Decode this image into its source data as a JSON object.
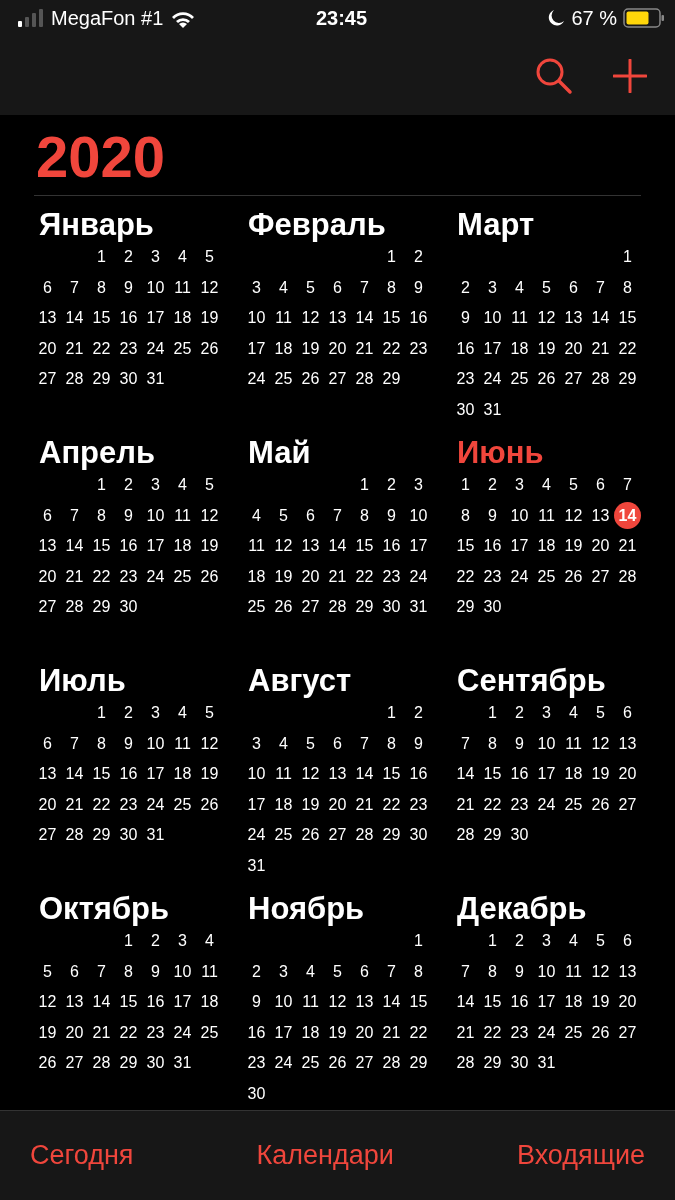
{
  "status_bar": {
    "carrier": "MegaFon #1",
    "time": "23:45",
    "battery": "67 %"
  },
  "year": "2020",
  "months": [
    {
      "name": "Январь",
      "current": false,
      "weeks": [
        [
          {
            "d": "1",
            "today": false
          },
          {
            "d": "2",
            "today": false
          },
          {
            "d": "3",
            "today": false
          },
          {
            "d": "4",
            "today": false
          },
          {
            "d": "5",
            "today": false
          }
        ],
        [
          {
            "d": "6",
            "today": false
          },
          {
            "d": "7",
            "today": false
          },
          {
            "d": "8",
            "today": false
          },
          {
            "d": "9",
            "today": false
          },
          {
            "d": "10",
            "today": false
          },
          {
            "d": "11",
            "today": false
          },
          {
            "d": "12",
            "today": false
          }
        ],
        [
          {
            "d": "13",
            "today": false
          },
          {
            "d": "14",
            "today": false
          },
          {
            "d": "15",
            "today": false
          },
          {
            "d": "16",
            "today": false
          },
          {
            "d": "17",
            "today": false
          },
          {
            "d": "18",
            "today": false
          },
          {
            "d": "19",
            "today": false
          }
        ],
        [
          {
            "d": "20",
            "today": false
          },
          {
            "d": "21",
            "today": false
          },
          {
            "d": "22",
            "today": false
          },
          {
            "d": "23",
            "today": false
          },
          {
            "d": "24",
            "today": false
          },
          {
            "d": "25",
            "today": false
          },
          {
            "d": "26",
            "today": false
          }
        ],
        [
          {
            "d": "27",
            "today": false
          },
          {
            "d": "28",
            "today": false
          },
          {
            "d": "29",
            "today": false
          },
          {
            "d": "30",
            "today": false
          },
          {
            "d": "31",
            "today": false
          }
        ]
      ]
    },
    {
      "name": "Февраль",
      "current": false,
      "weeks": [
        [
          {
            "d": "1",
            "today": false
          },
          {
            "d": "2",
            "today": false
          }
        ],
        [
          {
            "d": "3",
            "today": false
          },
          {
            "d": "4",
            "today": false
          },
          {
            "d": "5",
            "today": false
          },
          {
            "d": "6",
            "today": false
          },
          {
            "d": "7",
            "today": false
          },
          {
            "d": "8",
            "today": false
          },
          {
            "d": "9",
            "today": false
          }
        ],
        [
          {
            "d": "10",
            "today": false
          },
          {
            "d": "11",
            "today": false
          },
          {
            "d": "12",
            "today": false
          },
          {
            "d": "13",
            "today": false
          },
          {
            "d": "14",
            "today": false
          },
          {
            "d": "15",
            "today": false
          },
          {
            "d": "16",
            "today": false
          }
        ],
        [
          {
            "d": "17",
            "today": false
          },
          {
            "d": "18",
            "today": false
          },
          {
            "d": "19",
            "today": false
          },
          {
            "d": "20",
            "today": false
          },
          {
            "d": "21",
            "today": false
          },
          {
            "d": "22",
            "today": false
          },
          {
            "d": "23",
            "today": false
          }
        ],
        [
          {
            "d": "24",
            "today": false
          },
          {
            "d": "25",
            "today": false
          },
          {
            "d": "26",
            "today": false
          },
          {
            "d": "27",
            "today": false
          },
          {
            "d": "28",
            "today": false
          },
          {
            "d": "29",
            "today": false
          }
        ]
      ]
    },
    {
      "name": "Март",
      "current": false,
      "weeks": [
        [
          {
            "d": "1",
            "today": false
          }
        ],
        [
          {
            "d": "2",
            "today": false
          },
          {
            "d": "3",
            "today": false
          },
          {
            "d": "4",
            "today": false
          },
          {
            "d": "5",
            "today": false
          },
          {
            "d": "6",
            "today": false
          },
          {
            "d": "7",
            "today": false
          },
          {
            "d": "8",
            "today": false
          }
        ],
        [
          {
            "d": "9",
            "today": false
          },
          {
            "d": "10",
            "today": false
          },
          {
            "d": "11",
            "today": false
          },
          {
            "d": "12",
            "today": false
          },
          {
            "d": "13",
            "today": false
          },
          {
            "d": "14",
            "today": false
          },
          {
            "d": "15",
            "today": false
          }
        ],
        [
          {
            "d": "16",
            "today": false
          },
          {
            "d": "17",
            "today": false
          },
          {
            "d": "18",
            "today": false
          },
          {
            "d": "19",
            "today": false
          },
          {
            "d": "20",
            "today": false
          },
          {
            "d": "21",
            "today": false
          },
          {
            "d": "22",
            "today": false
          }
        ],
        [
          {
            "d": "23",
            "today": false
          },
          {
            "d": "24",
            "today": false
          },
          {
            "d": "25",
            "today": false
          },
          {
            "d": "26",
            "today": false
          },
          {
            "d": "27",
            "today": false
          },
          {
            "d": "28",
            "today": false
          },
          {
            "d": "29",
            "today": false
          }
        ],
        [
          {
            "d": "30",
            "today": false
          },
          {
            "d": "31",
            "today": false
          }
        ]
      ]
    },
    {
      "name": "Апрель",
      "current": false,
      "weeks": [
        [
          {
            "d": "1",
            "today": false
          },
          {
            "d": "2",
            "today": false
          },
          {
            "d": "3",
            "today": false
          },
          {
            "d": "4",
            "today": false
          },
          {
            "d": "5",
            "today": false
          }
        ],
        [
          {
            "d": "6",
            "today": false
          },
          {
            "d": "7",
            "today": false
          },
          {
            "d": "8",
            "today": false
          },
          {
            "d": "9",
            "today": false
          },
          {
            "d": "10",
            "today": false
          },
          {
            "d": "11",
            "today": false
          },
          {
            "d": "12",
            "today": false
          }
        ],
        [
          {
            "d": "13",
            "today": false
          },
          {
            "d": "14",
            "today": false
          },
          {
            "d": "15",
            "today": false
          },
          {
            "d": "16",
            "today": false
          },
          {
            "d": "17",
            "today": false
          },
          {
            "d": "18",
            "today": false
          },
          {
            "d": "19",
            "today": false
          }
        ],
        [
          {
            "d": "20",
            "today": false
          },
          {
            "d": "21",
            "today": false
          },
          {
            "d": "22",
            "today": false
          },
          {
            "d": "23",
            "today": false
          },
          {
            "d": "24",
            "today": false
          },
          {
            "d": "25",
            "today": false
          },
          {
            "d": "26",
            "today": false
          }
        ],
        [
          {
            "d": "27",
            "today": false
          },
          {
            "d": "28",
            "today": false
          },
          {
            "d": "29",
            "today": false
          },
          {
            "d": "30",
            "today": false
          }
        ]
      ]
    },
    {
      "name": "Май",
      "current": false,
      "weeks": [
        [
          {
            "d": "1",
            "today": false
          },
          {
            "d": "2",
            "today": false
          },
          {
            "d": "3",
            "today": false
          }
        ],
        [
          {
            "d": "4",
            "today": false
          },
          {
            "d": "5",
            "today": false
          },
          {
            "d": "6",
            "today": false
          },
          {
            "d": "7",
            "today": false
          },
          {
            "d": "8",
            "today": false
          },
          {
            "d": "9",
            "today": false
          },
          {
            "d": "10",
            "today": false
          }
        ],
        [
          {
            "d": "11",
            "today": false
          },
          {
            "d": "12",
            "today": false
          },
          {
            "d": "13",
            "today": false
          },
          {
            "d": "14",
            "today": false
          },
          {
            "d": "15",
            "today": false
          },
          {
            "d": "16",
            "today": false
          },
          {
            "d": "17",
            "today": false
          }
        ],
        [
          {
            "d": "18",
            "today": false
          },
          {
            "d": "19",
            "today": false
          },
          {
            "d": "20",
            "today": false
          },
          {
            "d": "21",
            "today": false
          },
          {
            "d": "22",
            "today": false
          },
          {
            "d": "23",
            "today": false
          },
          {
            "d": "24",
            "today": false
          }
        ],
        [
          {
            "d": "25",
            "today": false
          },
          {
            "d": "26",
            "today": false
          },
          {
            "d": "27",
            "today": false
          },
          {
            "d": "28",
            "today": false
          },
          {
            "d": "29",
            "today": false
          },
          {
            "d": "30",
            "today": false
          },
          {
            "d": "31",
            "today": false
          }
        ]
      ]
    },
    {
      "name": "Июнь",
      "current": true,
      "weeks": [
        [
          {
            "d": "1",
            "today": false
          },
          {
            "d": "2",
            "today": false
          },
          {
            "d": "3",
            "today": false
          },
          {
            "d": "4",
            "today": false
          },
          {
            "d": "5",
            "today": false
          },
          {
            "d": "6",
            "today": false
          },
          {
            "d": "7",
            "today": false
          }
        ],
        [
          {
            "d": "8",
            "today": false
          },
          {
            "d": "9",
            "today": false
          },
          {
            "d": "10",
            "today": false
          },
          {
            "d": "11",
            "today": false
          },
          {
            "d": "12",
            "today": false
          },
          {
            "d": "13",
            "today": false
          },
          {
            "d": "14",
            "today": true
          }
        ],
        [
          {
            "d": "15",
            "today": false
          },
          {
            "d": "16",
            "today": false
          },
          {
            "d": "17",
            "today": false
          },
          {
            "d": "18",
            "today": false
          },
          {
            "d": "19",
            "today": false
          },
          {
            "d": "20",
            "today": false
          },
          {
            "d": "21",
            "today": false
          }
        ],
        [
          {
            "d": "22",
            "today": false
          },
          {
            "d": "23",
            "today": false
          },
          {
            "d": "24",
            "today": false
          },
          {
            "d": "25",
            "today": false
          },
          {
            "d": "26",
            "today": false
          },
          {
            "d": "27",
            "today": false
          },
          {
            "d": "28",
            "today": false
          }
        ],
        [
          {
            "d": "29",
            "today": false
          },
          {
            "d": "30",
            "today": false
          }
        ]
      ]
    },
    {
      "name": "Июль",
      "current": false,
      "weeks": [
        [
          {
            "d": "1",
            "today": false
          },
          {
            "d": "2",
            "today": false
          },
          {
            "d": "3",
            "today": false
          },
          {
            "d": "4",
            "today": false
          },
          {
            "d": "5",
            "today": false
          }
        ],
        [
          {
            "d": "6",
            "today": false
          },
          {
            "d": "7",
            "today": false
          },
          {
            "d": "8",
            "today": false
          },
          {
            "d": "9",
            "today": false
          },
          {
            "d": "10",
            "today": false
          },
          {
            "d": "11",
            "today": false
          },
          {
            "d": "12",
            "today": false
          }
        ],
        [
          {
            "d": "13",
            "today": false
          },
          {
            "d": "14",
            "today": false
          },
          {
            "d": "15",
            "today": false
          },
          {
            "d": "16",
            "today": false
          },
          {
            "d": "17",
            "today": false
          },
          {
            "d": "18",
            "today": false
          },
          {
            "d": "19",
            "today": false
          }
        ],
        [
          {
            "d": "20",
            "today": false
          },
          {
            "d": "21",
            "today": false
          },
          {
            "d": "22",
            "today": false
          },
          {
            "d": "23",
            "today": false
          },
          {
            "d": "24",
            "today": false
          },
          {
            "d": "25",
            "today": false
          },
          {
            "d": "26",
            "today": false
          }
        ],
        [
          {
            "d": "27",
            "today": false
          },
          {
            "d": "28",
            "today": false
          },
          {
            "d": "29",
            "today": false
          },
          {
            "d": "30",
            "today": false
          },
          {
            "d": "31",
            "today": false
          }
        ]
      ]
    },
    {
      "name": "Август",
      "current": false,
      "weeks": [
        [
          {
            "d": "1",
            "today": false
          },
          {
            "d": "2",
            "today": false
          }
        ],
        [
          {
            "d": "3",
            "today": false
          },
          {
            "d": "4",
            "today": false
          },
          {
            "d": "5",
            "today": false
          },
          {
            "d": "6",
            "today": false
          },
          {
            "d": "7",
            "today": false
          },
          {
            "d": "8",
            "today": false
          },
          {
            "d": "9",
            "today": false
          }
        ],
        [
          {
            "d": "10",
            "today": false
          },
          {
            "d": "11",
            "today": false
          },
          {
            "d": "12",
            "today": false
          },
          {
            "d": "13",
            "today": false
          },
          {
            "d": "14",
            "today": false
          },
          {
            "d": "15",
            "today": false
          },
          {
            "d": "16",
            "today": false
          }
        ],
        [
          {
            "d": "17",
            "today": false
          },
          {
            "d": "18",
            "today": false
          },
          {
            "d": "19",
            "today": false
          },
          {
            "d": "20",
            "today": false
          },
          {
            "d": "21",
            "today": false
          },
          {
            "d": "22",
            "today": false
          },
          {
            "d": "23",
            "today": false
          }
        ],
        [
          {
            "d": "24",
            "today": false
          },
          {
            "d": "25",
            "today": false
          },
          {
            "d": "26",
            "today": false
          },
          {
            "d": "27",
            "today": false
          },
          {
            "d": "28",
            "today": false
          },
          {
            "d": "29",
            "today": false
          },
          {
            "d": "30",
            "today": false
          }
        ],
        [
          {
            "d": "31",
            "today": false
          }
        ]
      ]
    },
    {
      "name": "Сентябрь",
      "current": false,
      "weeks": [
        [
          {
            "d": "1",
            "today": false
          },
          {
            "d": "2",
            "today": false
          },
          {
            "d": "3",
            "today": false
          },
          {
            "d": "4",
            "today": false
          },
          {
            "d": "5",
            "today": false
          },
          {
            "d": "6",
            "today": false
          }
        ],
        [
          {
            "d": "7",
            "today": false
          },
          {
            "d": "8",
            "today": false
          },
          {
            "d": "9",
            "today": false
          },
          {
            "d": "10",
            "today": false
          },
          {
            "d": "11",
            "today": false
          },
          {
            "d": "12",
            "today": false
          },
          {
            "d": "13",
            "today": false
          }
        ],
        [
          {
            "d": "14",
            "today": false
          },
          {
            "d": "15",
            "today": false
          },
          {
            "d": "16",
            "today": false
          },
          {
            "d": "17",
            "today": false
          },
          {
            "d": "18",
            "today": false
          },
          {
            "d": "19",
            "today": false
          },
          {
            "d": "20",
            "today": false
          }
        ],
        [
          {
            "d": "21",
            "today": false
          },
          {
            "d": "22",
            "today": false
          },
          {
            "d": "23",
            "today": false
          },
          {
            "d": "24",
            "today": false
          },
          {
            "d": "25",
            "today": false
          },
          {
            "d": "26",
            "today": false
          },
          {
            "d": "27",
            "today": false
          }
        ],
        [
          {
            "d": "28",
            "today": false
          },
          {
            "d": "29",
            "today": false
          },
          {
            "d": "30",
            "today": false
          }
        ]
      ]
    },
    {
      "name": "Октябрь",
      "current": false,
      "weeks": [
        [
          {
            "d": "1",
            "today": false
          },
          {
            "d": "2",
            "today": false
          },
          {
            "d": "3",
            "today": false
          },
          {
            "d": "4",
            "today": false
          }
        ],
        [
          {
            "d": "5",
            "today": false
          },
          {
            "d": "6",
            "today": false
          },
          {
            "d": "7",
            "today": false
          },
          {
            "d": "8",
            "today": false
          },
          {
            "d": "9",
            "today": false
          },
          {
            "d": "10",
            "today": false
          },
          {
            "d": "11",
            "today": false
          }
        ],
        [
          {
            "d": "12",
            "today": false
          },
          {
            "d": "13",
            "today": false
          },
          {
            "d": "14",
            "today": false
          },
          {
            "d": "15",
            "today": false
          },
          {
            "d": "16",
            "today": false
          },
          {
            "d": "17",
            "today": false
          },
          {
            "d": "18",
            "today": false
          }
        ],
        [
          {
            "d": "19",
            "today": false
          },
          {
            "d": "20",
            "today": false
          },
          {
            "d": "21",
            "today": false
          },
          {
            "d": "22",
            "today": false
          },
          {
            "d": "23",
            "today": false
          },
          {
            "d": "24",
            "today": false
          },
          {
            "d": "25",
            "today": false
          }
        ],
        [
          {
            "d": "26",
            "today": false
          },
          {
            "d": "27",
            "today": false
          },
          {
            "d": "28",
            "today": false
          },
          {
            "d": "29",
            "today": false
          },
          {
            "d": "30",
            "today": false
          },
          {
            "d": "31",
            "today": false
          }
        ]
      ]
    },
    {
      "name": "Ноябрь",
      "current": false,
      "weeks": [
        [
          {
            "d": "1",
            "today": false
          }
        ],
        [
          {
            "d": "2",
            "today": false
          },
          {
            "d": "3",
            "today": false
          },
          {
            "d": "4",
            "today": false
          },
          {
            "d": "5",
            "today": false
          },
          {
            "d": "6",
            "today": false
          },
          {
            "d": "7",
            "today": false
          },
          {
            "d": "8",
            "today": false
          }
        ],
        [
          {
            "d": "9",
            "today": false
          },
          {
            "d": "10",
            "today": false
          },
          {
            "d": "11",
            "today": false
          },
          {
            "d": "12",
            "today": false
          },
          {
            "d": "13",
            "today": false
          },
          {
            "d": "14",
            "today": false
          },
          {
            "d": "15",
            "today": false
          }
        ],
        [
          {
            "d": "16",
            "today": false
          },
          {
            "d": "17",
            "today": false
          },
          {
            "d": "18",
            "today": false
          },
          {
            "d": "19",
            "today": false
          },
          {
            "d": "20",
            "today": false
          },
          {
            "d": "21",
            "today": false
          },
          {
            "d": "22",
            "today": false
          }
        ],
        [
          {
            "d": "23",
            "today": false
          },
          {
            "d": "24",
            "today": false
          },
          {
            "d": "25",
            "today": false
          },
          {
            "d": "26",
            "today": false
          },
          {
            "d": "27",
            "today": false
          },
          {
            "d": "28",
            "today": false
          },
          {
            "d": "29",
            "today": false
          }
        ],
        [
          {
            "d": "30",
            "today": false
          }
        ]
      ]
    },
    {
      "name": "Декабрь",
      "current": false,
      "weeks": [
        [
          {
            "d": "1",
            "today": false
          },
          {
            "d": "2",
            "today": false
          },
          {
            "d": "3",
            "today": false
          },
          {
            "d": "4",
            "today": false
          },
          {
            "d": "5",
            "today": false
          },
          {
            "d": "6",
            "today": false
          }
        ],
        [
          {
            "d": "7",
            "today": false
          },
          {
            "d": "8",
            "today": false
          },
          {
            "d": "9",
            "today": false
          },
          {
            "d": "10",
            "today": false
          },
          {
            "d": "11",
            "today": false
          },
          {
            "d": "12",
            "today": false
          },
          {
            "d": "13",
            "today": false
          }
        ],
        [
          {
            "d": "14",
            "today": false
          },
          {
            "d": "15",
            "today": false
          },
          {
            "d": "16",
            "today": false
          },
          {
            "d": "17",
            "today": false
          },
          {
            "d": "18",
            "today": false
          },
          {
            "d": "19",
            "today": false
          },
          {
            "d": "20",
            "today": false
          }
        ],
        [
          {
            "d": "21",
            "today": false
          },
          {
            "d": "22",
            "today": false
          },
          {
            "d": "23",
            "today": false
          },
          {
            "d": "24",
            "today": false
          },
          {
            "d": "25",
            "today": false
          },
          {
            "d": "26",
            "today": false
          },
          {
            "d": "27",
            "today": false
          }
        ],
        [
          {
            "d": "28",
            "today": false
          },
          {
            "d": "29",
            "today": false
          },
          {
            "d": "30",
            "today": false
          },
          {
            "d": "31",
            "today": false
          }
        ]
      ]
    }
  ],
  "tab_bar": [
    "Сегодня",
    "Календари",
    "Входящие"
  ]
}
